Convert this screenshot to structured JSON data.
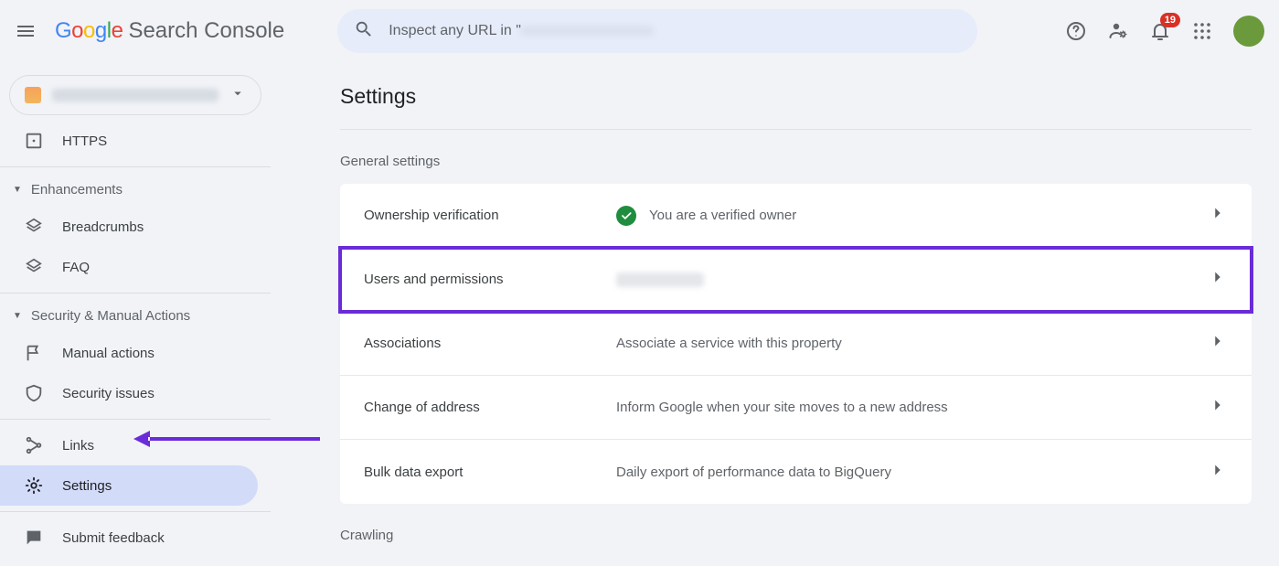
{
  "header": {
    "logo_google": "Google",
    "logo_product": "Search Console",
    "search_prefix": "Inspect any URL in \"",
    "search_blurred": "xxxxxxxxxxxxxxxxxx",
    "notifications_count": "19"
  },
  "sidebar": {
    "property_label": "████████████",
    "item_https": "HTTPS",
    "section_enhancements": "Enhancements",
    "item_breadcrumbs": "Breadcrumbs",
    "item_faq": "FAQ",
    "section_security": "Security & Manual Actions",
    "item_manual_actions": "Manual actions",
    "item_security_issues": "Security issues",
    "item_links": "Links",
    "item_settings": "Settings",
    "item_feedback": "Submit feedback"
  },
  "main": {
    "title": "Settings",
    "section_general": "General settings",
    "rows": {
      "ownership": {
        "label": "Ownership verification",
        "value": "You are a verified owner"
      },
      "users": {
        "label": "Users and permissions",
        "value": ""
      },
      "assoc": {
        "label": "Associations",
        "value": "Associate a service with this property"
      },
      "address": {
        "label": "Change of address",
        "value": "Inform Google when your site moves to a new address"
      },
      "bulk": {
        "label": "Bulk data export",
        "value": "Daily export of performance data to BigQuery"
      }
    },
    "section_crawling": "Crawling"
  }
}
